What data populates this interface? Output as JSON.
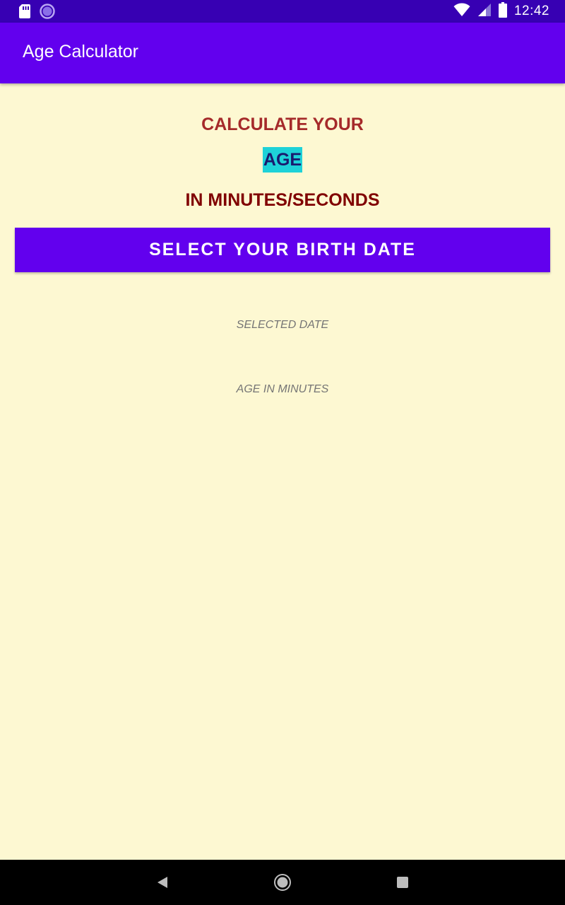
{
  "status_bar": {
    "time": "12:42",
    "icons": [
      "sd-card-icon",
      "sync-circle-icon",
      "wifi-icon",
      "cellular-signal-icon",
      "battery-icon"
    ],
    "background": "#3700b3"
  },
  "app_bar": {
    "title": "Age Calculator",
    "background": "#6200ee"
  },
  "main": {
    "heading_line1": "CALCULATE YOUR",
    "heading_line2": "AGE",
    "heading_line3": "IN MINUTES/SECONDS",
    "select_button_label": "SELECT YOUR BIRTH DATE",
    "selected_date_text": "SELECTED DATE",
    "age_in_minutes_text": "AGE IN MINUTES",
    "colors": {
      "background": "#fdf8d2",
      "heading1": "#a52a2a",
      "age_highlight_bg": "#1ed2d8",
      "age_text": "#1a1a6e",
      "heading3": "#800000",
      "button": "#6200ee"
    }
  },
  "nav_bar": {
    "icons": [
      "back-icon",
      "home-icon",
      "recents-icon"
    ]
  }
}
